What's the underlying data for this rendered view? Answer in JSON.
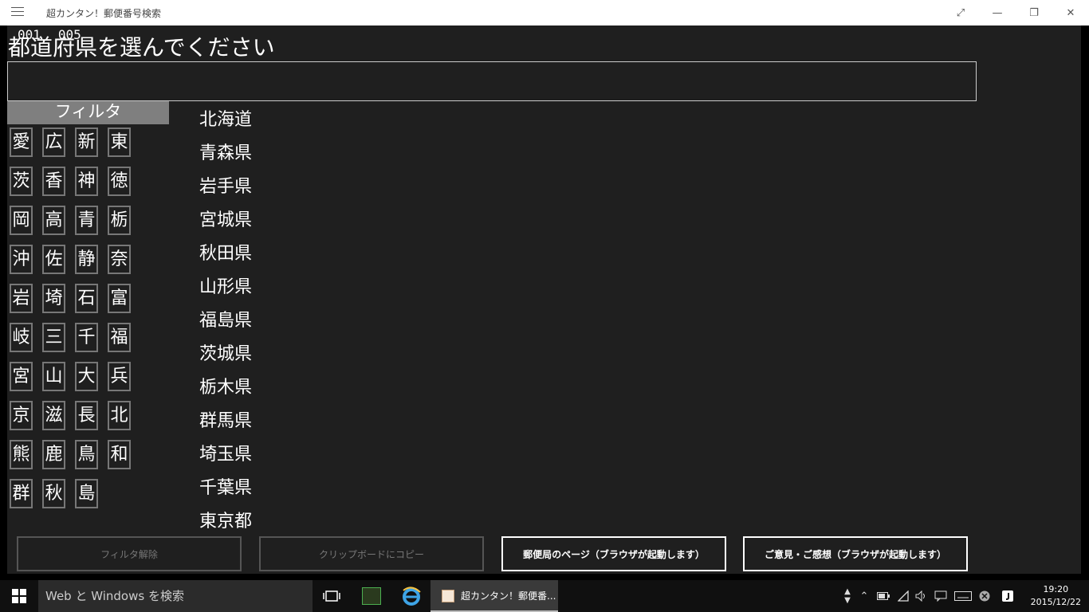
{
  "window": {
    "title": "超カンタン！郵便番号検索",
    "maximize_symbol": "⤢",
    "minimize_symbol": "—",
    "restore_symbol": "❐",
    "close_symbol": "✕"
  },
  "codes": [
    "001",
    "005"
  ],
  "prompt": "都道府県を選んでください",
  "search": {
    "value": ""
  },
  "filter": {
    "header": "フィルタ",
    "kanji": [
      [
        "愛",
        "広",
        "新",
        "東"
      ],
      [
        "茨",
        "香",
        "神",
        "徳"
      ],
      [
        "岡",
        "高",
        "青",
        "栃"
      ],
      [
        "沖",
        "佐",
        "静",
        "奈"
      ],
      [
        "岩",
        "埼",
        "石",
        "富"
      ],
      [
        "岐",
        "三",
        "千",
        "福"
      ],
      [
        "宮",
        "山",
        "大",
        "兵"
      ],
      [
        "京",
        "滋",
        "長",
        "北"
      ],
      [
        "熊",
        "鹿",
        "鳥",
        "和"
      ],
      [
        "群",
        "秋",
        "島"
      ]
    ]
  },
  "prefectures": [
    "北海道",
    "青森県",
    "岩手県",
    "宮城県",
    "秋田県",
    "山形県",
    "福島県",
    "茨城県",
    "栃木県",
    "群馬県",
    "埼玉県",
    "千葉県",
    "東京都"
  ],
  "buttons": {
    "clear_filter": "フィルタ解除",
    "copy_clipboard": "クリップボードにコピー",
    "post_office_page": "郵便局のページ（ブラウザが起動します）",
    "feedback": "ご意見・ご感想（ブラウザが起動します）"
  },
  "taskbar": {
    "search_placeholder": "Web と Windows を検索",
    "app_label": "超カンタン！郵便番...",
    "time": "19:20",
    "date": "2015/12/22"
  }
}
